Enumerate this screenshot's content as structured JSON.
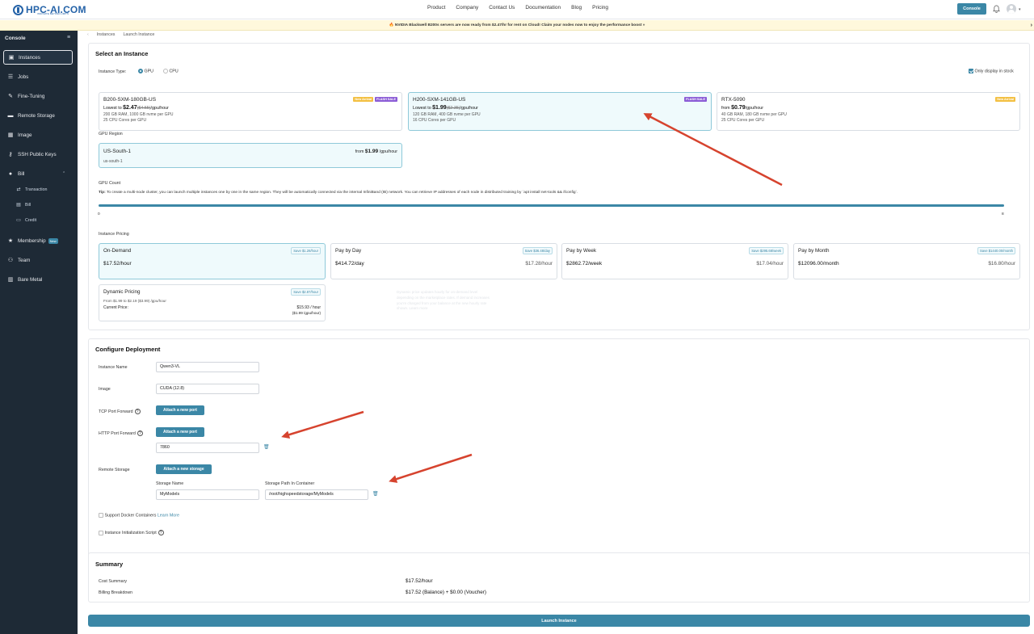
{
  "brand": {
    "name": "HPC-AI.COM",
    "tagline": "INNOVATE BEYOND LIMITS"
  },
  "topnav": {
    "items": [
      "Product",
      "Company",
      "Contact Us",
      "Documentation",
      "Blog",
      "Pricing"
    ],
    "console_button": "Console"
  },
  "banner": {
    "text": "🔥 NVIDIA Blackwell B200s servers are now ready from $2.47/hr for rent on Cloud! Claim your nodes now to enjoy the performance boost »",
    "close": "›"
  },
  "sidebar": {
    "title": "Console",
    "items": [
      {
        "label": "Instances",
        "icon": "server-icon"
      },
      {
        "label": "Jobs",
        "icon": "list-icon"
      },
      {
        "label": "Fine-Tuning",
        "icon": "wrench-icon"
      },
      {
        "label": "Remote Storage",
        "icon": "storage-icon"
      },
      {
        "label": "Image",
        "icon": "grid-icon"
      },
      {
        "label": "SSH Public Keys",
        "icon": "key-icon"
      },
      {
        "label": "Bill",
        "icon": "info-icon"
      }
    ],
    "bill_sub": [
      {
        "label": "Transaction"
      },
      {
        "label": "Bill"
      },
      {
        "label": "Credit"
      }
    ],
    "membership": {
      "label": "Membership",
      "badge": "New"
    },
    "team": {
      "label": "Team"
    },
    "bare_metal": {
      "label": "Bare Metal"
    }
  },
  "breadcrumb": {
    "parent": "Instances",
    "current": "Launch Instance"
  },
  "select_instance": {
    "title": "Select an Instance",
    "type_label": "Instance Type:",
    "gpu": "GPU",
    "cpu": "CPU",
    "stock_label": "Only display in stock",
    "cards": [
      {
        "name": "B200-SXM-180GB-US",
        "prefix": "Lowest to ",
        "price": "$2.47",
        "old": "($4.55)",
        "unit": "/gpu/hour",
        "spec1": "200 GB RAM, 1000 GB nvme per GPU",
        "spec2": "25 CPU Cores per GPU",
        "badge1": "New Arrival",
        "badge2": "FLASH SALE"
      },
      {
        "name": "H200-SXM-141GB-US",
        "prefix": "Lowest to ",
        "price": "$1.99",
        "old": "($2.35)",
        "unit": "/gpu/hour",
        "spec1": "120 GB RAM, 400 GB nvme per GPU",
        "spec2": "16 CPU Cores per GPU",
        "badge2": "FLASH SALE"
      },
      {
        "name": "RTX-5090",
        "prefix": "from ",
        "price": "$0.79",
        "unit": "/gpu/hour",
        "spec1": "40 GB RAM, 180 GB nvme per GPU",
        "spec2": "25 CPU Cores per GPU",
        "badge1": "New Arrival"
      }
    ],
    "region_label": "GPU Region",
    "region": {
      "name": "US-South-1",
      "id": "us-south-1",
      "from": "from ",
      "price": "$1.99",
      "unit": " /gpu/hour"
    },
    "gpu_count_label": "GPU Count",
    "tip_label": "Tip:",
    "tip": " To create a multi-node cluster, you can launch multiple instances one by one in the same region. They will be automatically connected via the internal InfiniBand (IB) network. You can retrieve IP addresses of each node in distributed training by `apt install net-tools && ifconfig`.",
    "slider_min": "0",
    "slider_max": "8",
    "pricing_label": "Instance Pricing",
    "pricing": [
      {
        "title": "On-Demand",
        "save": "Save $1.28/hour",
        "value": "$17.52/hour",
        "right": ""
      },
      {
        "title": "Pay by Day",
        "save": "Save $36.48/day",
        "value": "$414.72/day",
        "right": "$17.28/hour"
      },
      {
        "title": "Pay by Week",
        "save": "Save $295.68/week",
        "value": "$2862.72/week",
        "right": "$17.04/hour"
      },
      {
        "title": "Pay by Month",
        "save": "Save $1440.00/month",
        "value": "$12096.00/month",
        "right": "$16.80/hour"
      }
    ],
    "dynamic": {
      "title": "Dynamic Pricing",
      "save": "Save $2.87/hour",
      "range": "From $1.99 to $2.19 ($3.99) /gpu/hour",
      "current_label": "Current Price:",
      "current": "$15.93 / hour",
      "current_sub": "($1.99 /gpu/hour)"
    },
    "ghost_text": "Dynamic price updates hourly for on-demand level depending on the marketplace rates. If demand increases you're charged from your balance at the new hourly rate shown. Learn more"
  },
  "configure": {
    "title": "Configure Deployment",
    "name_label": "Instance Name",
    "name_value": "Qwen3-VL",
    "image_label": "Image",
    "image_value": "CUDA (12.8)",
    "tcp_label": "TCP Port Forward",
    "http_label": "HTTP Port Forward",
    "attach_port": "Attach a new port",
    "http_port_value": "7860",
    "storage_label": "Remote Storage",
    "attach_storage": "Attach a new storage",
    "storage_name_label": "Storage Name",
    "storage_path_label": "Storage Path In Container",
    "storage_name_value": "MyModels",
    "storage_path_value": "/root/highspeedstorage/MyModels",
    "docker_label": "Support Docker Containers",
    "learn_more": "Learn More",
    "init_label": "Instance Initialization Script"
  },
  "summary": {
    "title": "Summary",
    "cost_label": "Cost Summary",
    "cost": "$17.52/hour",
    "billing_label": "Billing Breakdown",
    "billing": "$17.52 (Balance) + $0.00 (Voucher)"
  },
  "launch_label": "Launch Instance",
  "colors": {
    "accent": "#3b87a6",
    "sidebar": "#1e2a36",
    "annotation": "#d6432e"
  }
}
